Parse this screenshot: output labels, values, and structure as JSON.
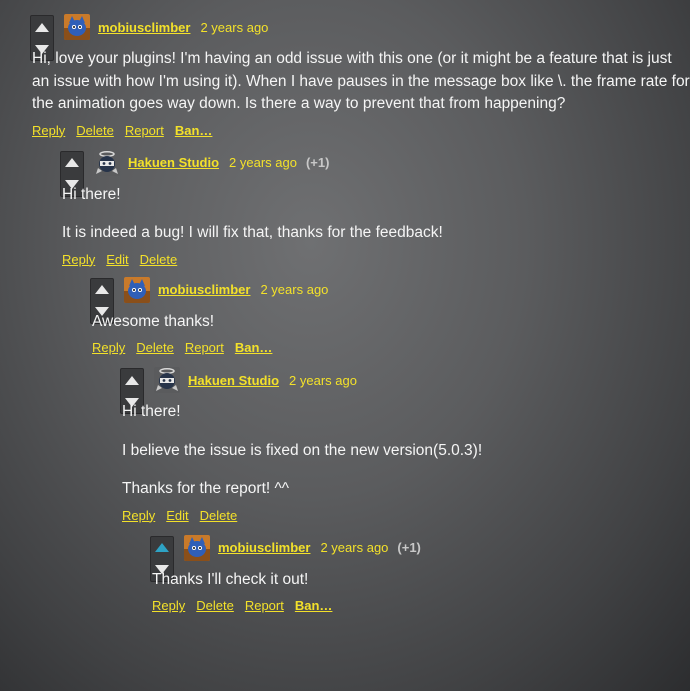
{
  "colors": {
    "accent": "#f3e12a",
    "voted": "#2ea3c5",
    "text": "#f5f5f5"
  },
  "comments": [
    {
      "id": "c1",
      "user": "mobiusclimber",
      "time": "2 years ago",
      "score": "",
      "avatar": "blue-creature-avatar",
      "paragraphs": [
        "Hi, love your plugins! I'm having an odd issue with this one (or it might be a feature that is just an issue with how I'm using it). When I have pauses in the message box like \\. the frame rate for the animation goes way down. Is there a way to prevent that from happening?"
      ],
      "actions": [
        "Reply",
        "Delete",
        "Report",
        "Ban…"
      ]
    },
    {
      "id": "c2",
      "user": "Hakuen Studio",
      "time": "2 years ago",
      "score": "(+1)",
      "avatar": "ninja-angel-avatar",
      "paragraphs": [
        "Hi there!",
        "It is indeed a bug! I will fix that, thanks for the feedback!"
      ],
      "actions": [
        "Reply",
        "Edit",
        "Delete"
      ]
    },
    {
      "id": "c3",
      "user": "mobiusclimber",
      "time": "2 years ago",
      "score": "",
      "avatar": "blue-creature-avatar",
      "paragraphs": [
        "Awesome thanks!"
      ],
      "actions": [
        "Reply",
        "Delete",
        "Report",
        "Ban…"
      ]
    },
    {
      "id": "c4",
      "user": "Hakuen Studio",
      "time": "2 years ago",
      "score": "",
      "avatar": "ninja-angel-avatar",
      "paragraphs": [
        "Hi there!",
        "I believe the issue is fixed on the new version(5.0.3)!",
        "Thanks for the report! ^^"
      ],
      "actions": [
        "Reply",
        "Edit",
        "Delete"
      ]
    },
    {
      "id": "c5",
      "user": "mobiusclimber",
      "time": "2 years ago",
      "score": "(+1)",
      "upvoted": true,
      "avatar": "blue-creature-avatar",
      "paragraphs": [
        "Thanks I'll check it out!"
      ],
      "actions": [
        "Reply",
        "Delete",
        "Report",
        "Ban…"
      ]
    }
  ]
}
